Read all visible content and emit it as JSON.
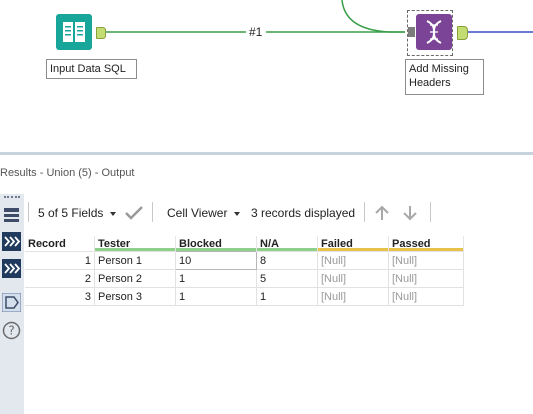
{
  "canvas": {
    "input_tool": {
      "label": "Input Data SQL",
      "icon": "book-icon",
      "color": "#18a69a"
    },
    "connection_label": "#1",
    "dna_tool": {
      "label": "Add Missing Headers",
      "icon": "dna-icon",
      "color": "#7b4497"
    },
    "wire_colors": {
      "green": "#3a9f49",
      "blue": "#3b4fc8"
    }
  },
  "results": {
    "title": "Results - Union (5) - Output",
    "toolbar": {
      "fields_label": "5 of 5 Fields",
      "viewer_label": "Cell Viewer",
      "records_label": "3 records displayed"
    },
    "grid": {
      "columns": [
        {
          "name": "Record",
          "color": ""
        },
        {
          "name": "Tester",
          "color": "#8ecf8a"
        },
        {
          "name": "Blocked",
          "color": "#8ecf8a"
        },
        {
          "name": "N/A",
          "color": "#8ecf8a"
        },
        {
          "name": "Failed",
          "color": "#e6c24b"
        },
        {
          "name": "Passed",
          "color": "#e6c24b"
        }
      ],
      "rows": [
        [
          "1",
          "Person 1",
          "10",
          "8",
          "[Null]",
          "[Null]"
        ],
        [
          "2",
          "Person 2",
          "1",
          "5",
          "[Null]",
          "[Null]"
        ],
        [
          "3",
          "Person 3",
          "1",
          "1",
          "[Null]",
          "[Null]"
        ]
      ]
    }
  }
}
